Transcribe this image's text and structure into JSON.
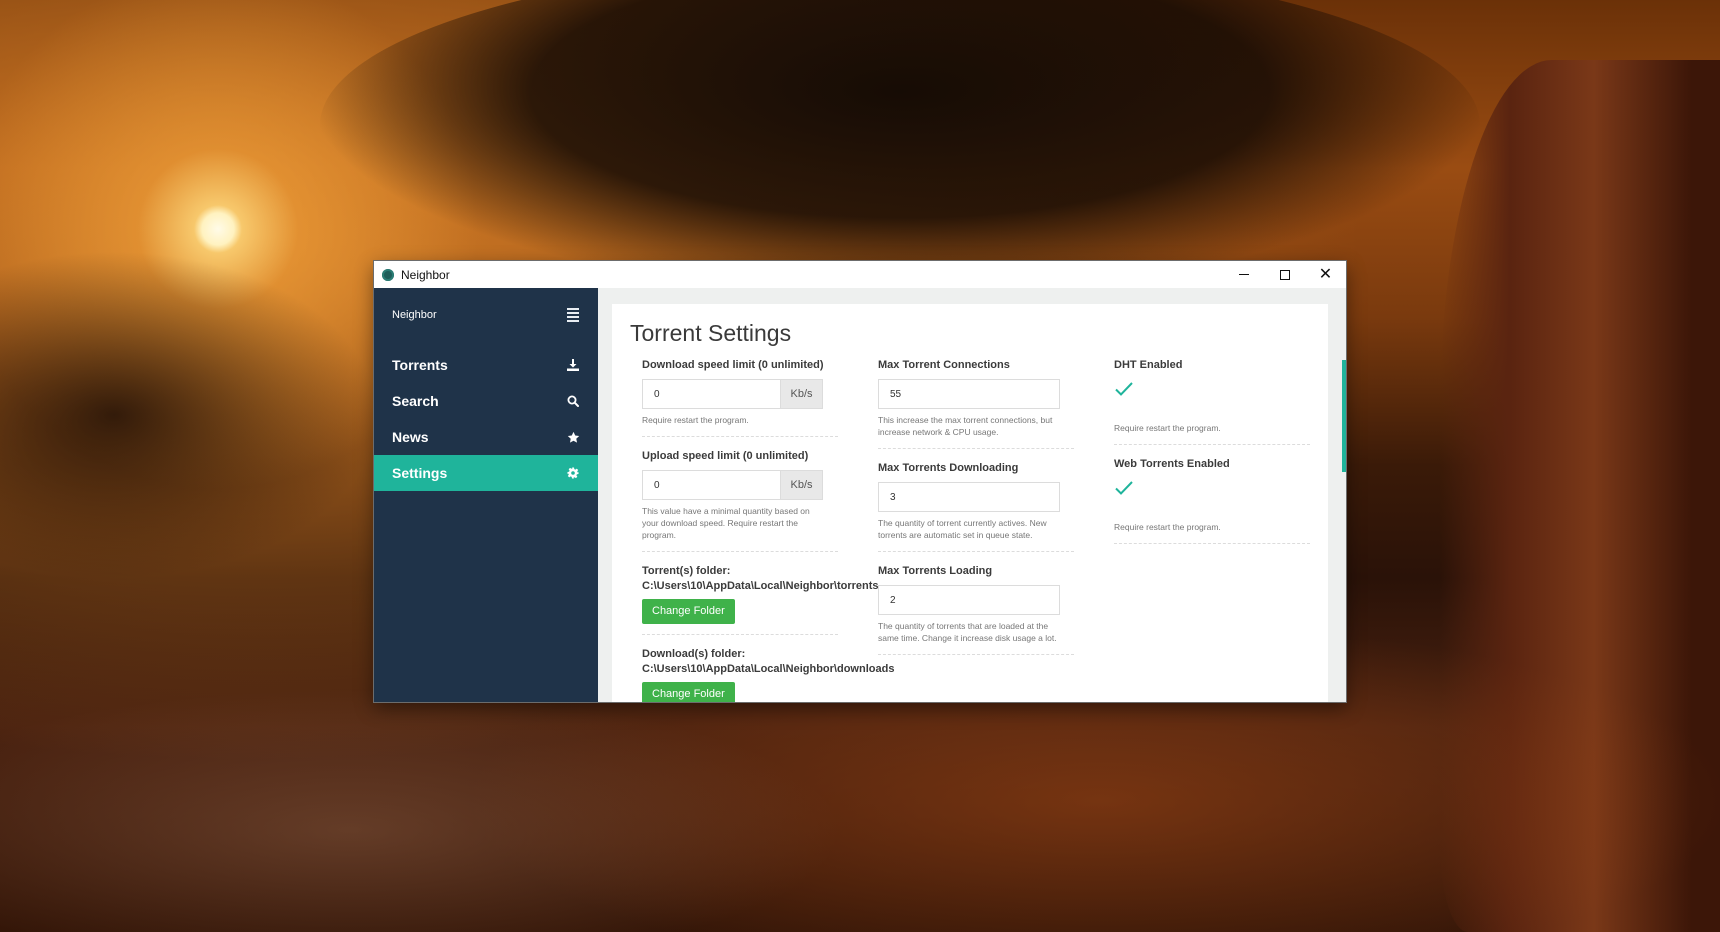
{
  "window": {
    "title": "Neighbor",
    "controls": {
      "minimize": "minimize-icon",
      "maximize": "maximize-icon",
      "close": "close-icon"
    }
  },
  "sidebar": {
    "brand": "Neighbor",
    "items": [
      {
        "label": "Torrents",
        "icon": "download-icon",
        "active": false
      },
      {
        "label": "Search",
        "icon": "search-icon",
        "active": false
      },
      {
        "label": "News",
        "icon": "star-icon",
        "active": false
      },
      {
        "label": "Settings",
        "icon": "gear-icon",
        "active": true
      }
    ]
  },
  "colors": {
    "sidebar": "#1f3349",
    "accent": "#1fb49b",
    "button": "#3fb24a"
  },
  "page": {
    "title": "Torrent Settings"
  },
  "settings": {
    "download_limit": {
      "label": "Download speed limit (0 unlimited)",
      "value": "0",
      "unit": "Kb/s",
      "help": "Require restart the program."
    },
    "upload_limit": {
      "label": "Upload speed limit (0 unlimited)",
      "value": "0",
      "unit": "Kb/s",
      "help": "This value have a minimal quantity based on your download speed. Require restart the program."
    },
    "torrent_folder": {
      "label": "Torrent(s) folder:",
      "path": "C:\\Users\\10\\AppData\\Local\\Neighbor\\torrents",
      "button": "Change Folder"
    },
    "download_folder": {
      "label": "Download(s) folder:",
      "path": "C:\\Users\\10\\AppData\\Local\\Neighbor\\downloads",
      "button": "Change Folder"
    },
    "max_connections": {
      "label": "Max Torrent Connections",
      "value": "55",
      "help": "This increase the max torrent connections, but increase network & CPU usage."
    },
    "max_downloading": {
      "label": "Max Torrents Downloading",
      "value": "3",
      "help": "The quantity of torrent currently actives. New torrents are automatic set in queue state."
    },
    "max_loading": {
      "label": "Max Torrents Loading",
      "value": "2",
      "help": "The quantity of torrents that are loaded at the same time. Change it increase disk usage a lot."
    },
    "dht": {
      "label": "DHT Enabled",
      "checked": true,
      "help": "Require restart the program."
    },
    "web_torrents": {
      "label": "Web Torrents Enabled",
      "checked": true,
      "help": "Require restart the program."
    }
  }
}
